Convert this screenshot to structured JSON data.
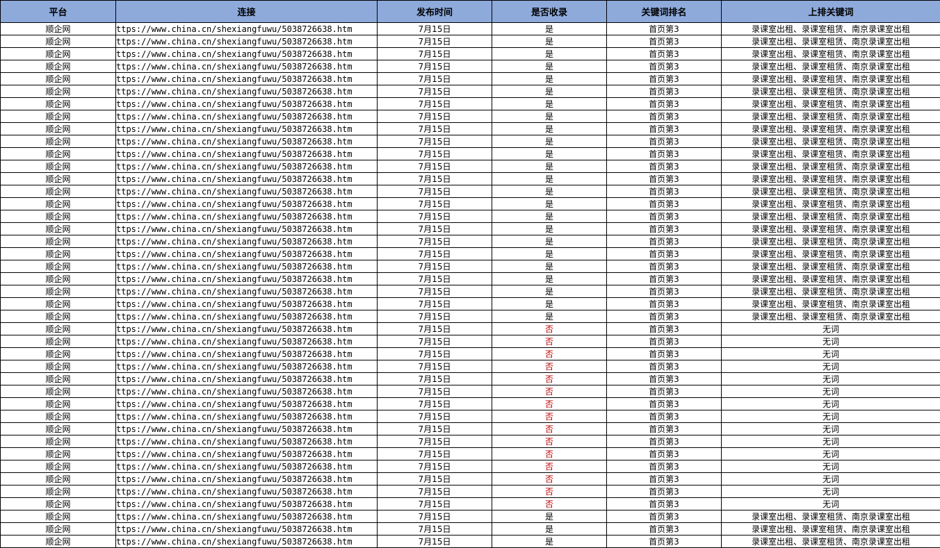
{
  "colors": {
    "header_bg": "#8eaadb",
    "not_indexed_text": "#c00000",
    "grid_line": "#000000"
  },
  "headers": [
    "平台",
    "连接",
    "发布时间",
    "是否收录",
    "关键词排名",
    "上排关键词"
  ],
  "rows": [
    [
      "顺企网",
      "ttps://www.china.cn/shexiangfuwu/5038726638.htm",
      "7月15日",
      "是",
      "首页第3",
      "录课室出租、录课室租赁、南京录课室出租"
    ],
    [
      "顺企网",
      "ttps://www.china.cn/shexiangfuwu/5038726638.htm",
      "7月15日",
      "是",
      "首页第3",
      "录课室出租、录课室租赁、南京录课室出租"
    ],
    [
      "顺企网",
      "ttps://www.china.cn/shexiangfuwu/5038726638.htm",
      "7月15日",
      "是",
      "首页第3",
      "录课室出租、录课室租赁、南京录课室出租"
    ],
    [
      "顺企网",
      "ttps://www.china.cn/shexiangfuwu/5038726638.htm",
      "7月15日",
      "是",
      "首页第3",
      "录课室出租、录课室租赁、南京录课室出租"
    ],
    [
      "顺企网",
      "ttps://www.china.cn/shexiangfuwu/5038726638.htm",
      "7月15日",
      "是",
      "首页第3",
      "录课室出租、录课室租赁、南京录课室出租"
    ],
    [
      "顺企网",
      "ttps://www.china.cn/shexiangfuwu/5038726638.htm",
      "7月15日",
      "是",
      "首页第3",
      "录课室出租、录课室租赁、南京录课室出租"
    ],
    [
      "顺企网",
      "ttps://www.china.cn/shexiangfuwu/5038726638.htm",
      "7月15日",
      "是",
      "首页第3",
      "录课室出租、录课室租赁、南京录课室出租"
    ],
    [
      "顺企网",
      "ttps://www.china.cn/shexiangfuwu/5038726638.htm",
      "7月15日",
      "是",
      "首页第3",
      "录课室出租、录课室租赁、南京录课室出租"
    ],
    [
      "顺企网",
      "ttps://www.china.cn/shexiangfuwu/5038726638.htm",
      "7月15日",
      "是",
      "首页第3",
      "录课室出租、录课室租赁、南京录课室出租"
    ],
    [
      "顺企网",
      "ttps://www.china.cn/shexiangfuwu/5038726638.htm",
      "7月15日",
      "是",
      "首页第3",
      "录课室出租、录课室租赁、南京录课室出租"
    ],
    [
      "顺企网",
      "ttps://www.china.cn/shexiangfuwu/5038726638.htm",
      "7月15日",
      "是",
      "首页第3",
      "录课室出租、录课室租赁、南京录课室出租"
    ],
    [
      "顺企网",
      "ttps://www.china.cn/shexiangfuwu/5038726638.htm",
      "7月15日",
      "是",
      "首页第3",
      "录课室出租、录课室租赁、南京录课室出租"
    ],
    [
      "顺企网",
      "ttps://www.china.cn/shexiangfuwu/5038726638.htm",
      "7月15日",
      "是",
      "首页第3",
      "录课室出租、录课室租赁、南京录课室出租"
    ],
    [
      "顺企网",
      "ttps://www.china.cn/shexiangfuwu/5038726638.htm",
      "7月15日",
      "是",
      "首页第3",
      "录课室出租、录课室租赁、南京录课室出租"
    ],
    [
      "顺企网",
      "ttps://www.china.cn/shexiangfuwu/5038726638.htm",
      "7月15日",
      "是",
      "首页第3",
      "录课室出租、录课室租赁、南京录课室出租"
    ],
    [
      "顺企网",
      "ttps://www.china.cn/shexiangfuwu/5038726638.htm",
      "7月15日",
      "是",
      "首页第3",
      "录课室出租、录课室租赁、南京录课室出租"
    ],
    [
      "顺企网",
      "ttps://www.china.cn/shexiangfuwu/5038726638.htm",
      "7月15日",
      "是",
      "首页第3",
      "录课室出租、录课室租赁、南京录课室出租"
    ],
    [
      "顺企网",
      "ttps://www.china.cn/shexiangfuwu/5038726638.htm",
      "7月15日",
      "是",
      "首页第3",
      "录课室出租、录课室租赁、南京录课室出租"
    ],
    [
      "顺企网",
      "ttps://www.china.cn/shexiangfuwu/5038726638.htm",
      "7月15日",
      "是",
      "首页第3",
      "录课室出租、录课室租赁、南京录课室出租"
    ],
    [
      "顺企网",
      "ttps://www.china.cn/shexiangfuwu/5038726638.htm",
      "7月15日",
      "是",
      "首页第3",
      "录课室出租、录课室租赁、南京录课室出租"
    ],
    [
      "顺企网",
      "ttps://www.china.cn/shexiangfuwu/5038726638.htm",
      "7月15日",
      "是",
      "首页第3",
      "录课室出租、录课室租赁、南京录课室出租"
    ],
    [
      "顺企网",
      "ttps://www.china.cn/shexiangfuwu/5038726638.htm",
      "7月15日",
      "是",
      "首页第3",
      "录课室出租、录课室租赁、南京录课室出租"
    ],
    [
      "顺企网",
      "ttps://www.china.cn/shexiangfuwu/5038726638.htm",
      "7月15日",
      "是",
      "首页第3",
      "录课室出租、录课室租赁、南京录课室出租"
    ],
    [
      "顺企网",
      "ttps://www.china.cn/shexiangfuwu/5038726638.htm",
      "7月15日",
      "是",
      "首页第3",
      "录课室出租、录课室租赁、南京录课室出租"
    ],
    [
      "顺企网",
      "ttps://www.china.cn/shexiangfuwu/5038726638.htm",
      "7月15日",
      "否",
      "首页第3",
      "无词"
    ],
    [
      "顺企网",
      "ttps://www.china.cn/shexiangfuwu/5038726638.htm",
      "7月15日",
      "否",
      "首页第3",
      "无词"
    ],
    [
      "顺企网",
      "ttps://www.china.cn/shexiangfuwu/5038726638.htm",
      "7月15日",
      "否",
      "首页第3",
      "无词"
    ],
    [
      "顺企网",
      "ttps://www.china.cn/shexiangfuwu/5038726638.htm",
      "7月15日",
      "否",
      "首页第3",
      "无词"
    ],
    [
      "顺企网",
      "ttps://www.china.cn/shexiangfuwu/5038726638.htm",
      "7月15日",
      "否",
      "首页第3",
      "无词"
    ],
    [
      "顺企网",
      "ttps://www.china.cn/shexiangfuwu/5038726638.htm",
      "7月15日",
      "否",
      "首页第3",
      "无词"
    ],
    [
      "顺企网",
      "ttps://www.china.cn/shexiangfuwu/5038726638.htm",
      "7月15日",
      "否",
      "首页第3",
      "无词"
    ],
    [
      "顺企网",
      "ttps://www.china.cn/shexiangfuwu/5038726638.htm",
      "7月15日",
      "否",
      "首页第3",
      "无词"
    ],
    [
      "顺企网",
      "ttps://www.china.cn/shexiangfuwu/5038726638.htm",
      "7月15日",
      "否",
      "首页第3",
      "无词"
    ],
    [
      "顺企网",
      "ttps://www.china.cn/shexiangfuwu/5038726638.htm",
      "7月15日",
      "否",
      "首页第3",
      "无词"
    ],
    [
      "顺企网",
      "ttps://www.china.cn/shexiangfuwu/5038726638.htm",
      "7月15日",
      "否",
      "首页第3",
      "无词"
    ],
    [
      "顺企网",
      "ttps://www.china.cn/shexiangfuwu/5038726638.htm",
      "7月15日",
      "否",
      "首页第3",
      "无词"
    ],
    [
      "顺企网",
      "ttps://www.china.cn/shexiangfuwu/5038726638.htm",
      "7月15日",
      "否",
      "首页第3",
      "无词"
    ],
    [
      "顺企网",
      "ttps://www.china.cn/shexiangfuwu/5038726638.htm",
      "7月15日",
      "否",
      "首页第3",
      "无词"
    ],
    [
      "顺企网",
      "ttps://www.china.cn/shexiangfuwu/5038726638.htm",
      "7月15日",
      "否",
      "首页第3",
      "无词"
    ],
    [
      "顺企网",
      "ttps://www.china.cn/shexiangfuwu/5038726638.htm",
      "7月15日",
      "是",
      "首页第3",
      "录课室出租、录课室租赁、南京录课室出租"
    ],
    [
      "顺企网",
      "ttps://www.china.cn/shexiangfuwu/5038726638.htm",
      "7月15日",
      "是",
      "首页第3",
      "录课室出租、录课室租赁、南京录课室出租"
    ],
    [
      "顺企网",
      "ttps://www.china.cn/shexiangfuwu/5038726638.htm",
      "7月15日",
      "是",
      "首页第3",
      "录课室出租、录课室租赁、南京录课室出租"
    ]
  ]
}
